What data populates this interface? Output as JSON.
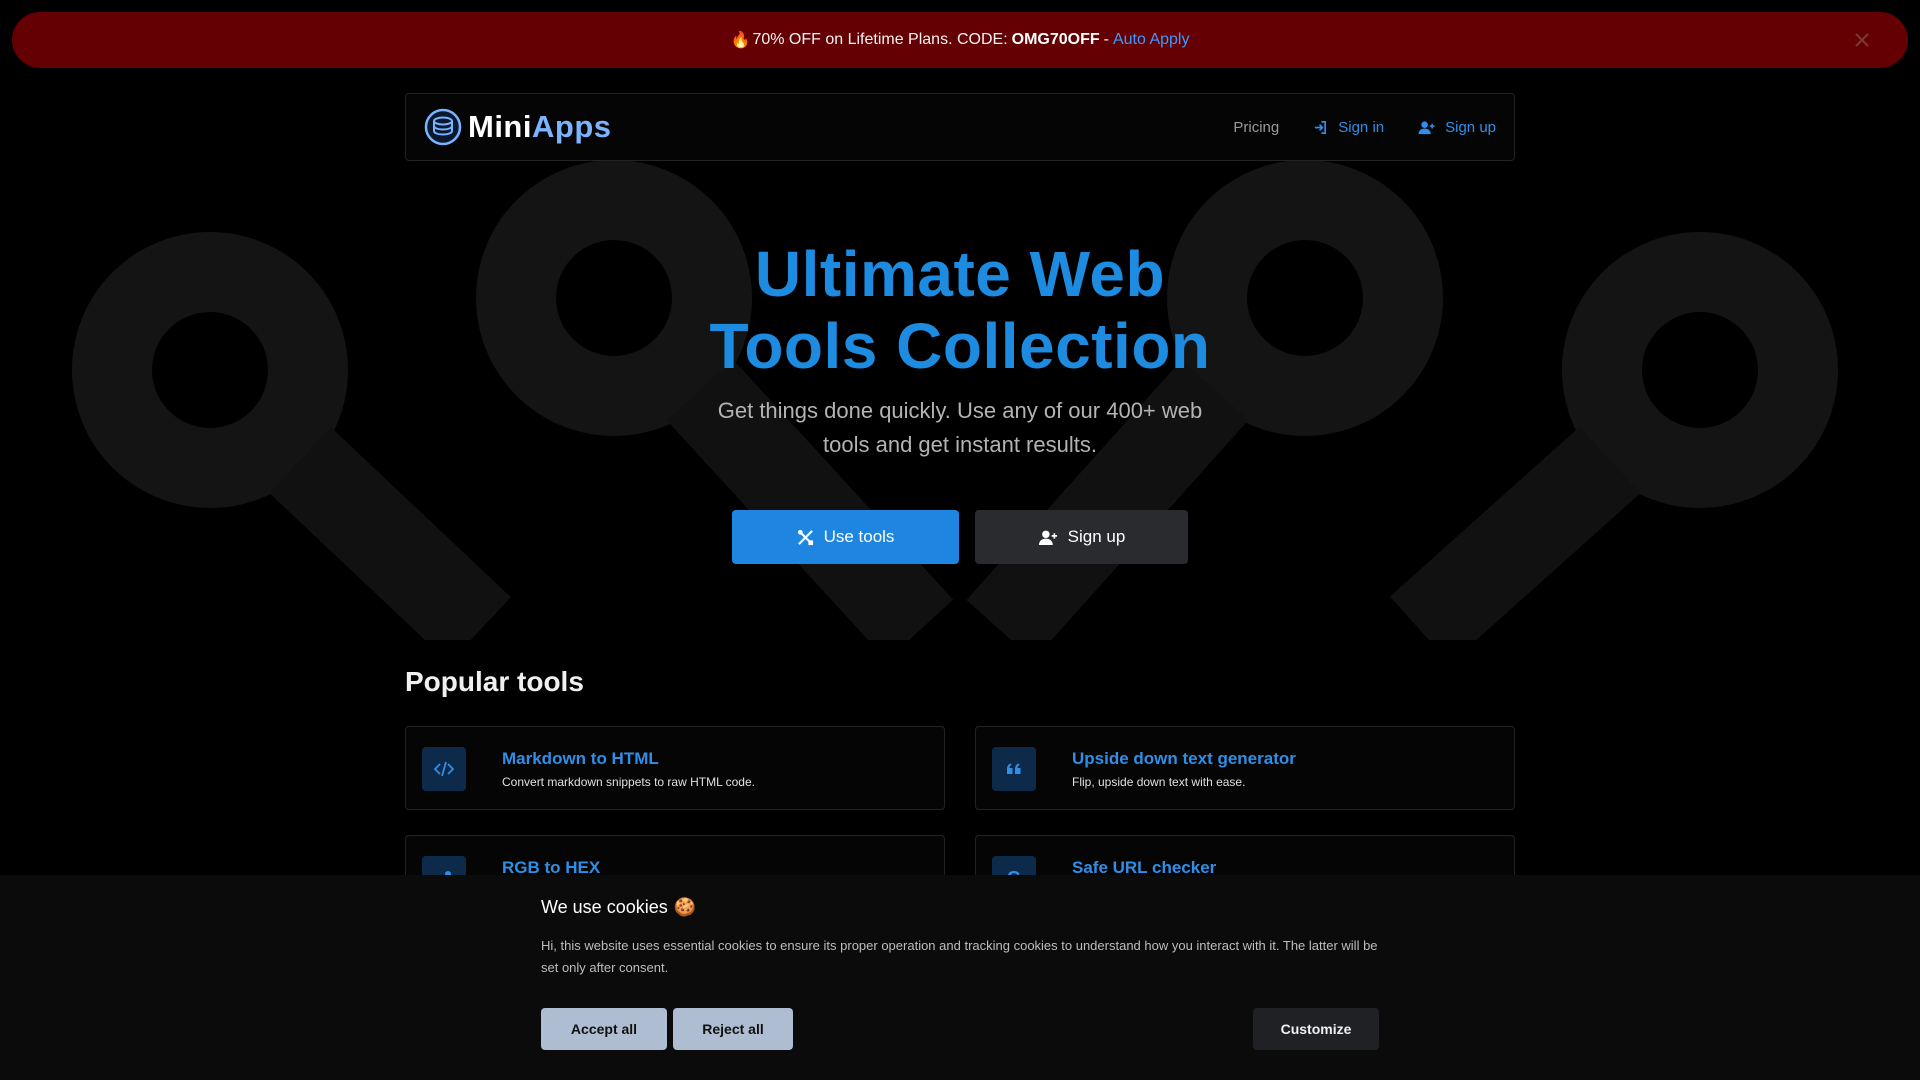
{
  "promo": {
    "emoji": "🔥",
    "text": "70% OFF on Lifetime Plans. CODE:",
    "code": "OMG70OFF",
    "separator": "-",
    "apply_label": "Auto Apply"
  },
  "nav": {
    "brand_mini": "Mini",
    "brand_apps": "Apps",
    "pricing": "Pricing",
    "sign_in": "Sign in",
    "sign_up": "Sign up"
  },
  "hero": {
    "title": "Ultimate Web Tools Collection",
    "subtitle": "Get things done quickly. Use any of our 400+ web tools and get instant results.",
    "use_tools": "Use tools",
    "sign_up": "Sign up"
  },
  "popular": {
    "title": "Popular tools",
    "tools": [
      {
        "name": "Markdown to HTML",
        "desc": "Convert markdown snippets to raw HTML code.",
        "icon": "code-icon"
      },
      {
        "name": "Upside down text generator",
        "desc": "Flip, upside down text with ease.",
        "icon": "quote-icon"
      },
      {
        "name": "RGB to HEX",
        "desc": "",
        "icon": "eyedropper-icon"
      },
      {
        "name": "Safe URL checker",
        "desc": "",
        "icon": "google-icon"
      }
    ]
  },
  "cookie": {
    "title": "We use cookies",
    "emoji": "🍪",
    "text": "Hi, this website uses essential cookies to ensure its proper operation and tracking cookies to understand how you interact with it. The latter will be set only after consent.",
    "accept_all": "Accept all",
    "reject_all": "Reject all",
    "customize": "Customize"
  },
  "colors": {
    "accent": "#1e86e0",
    "promo_bg": "#640004",
    "brand_apps": "#7ab4ff"
  }
}
